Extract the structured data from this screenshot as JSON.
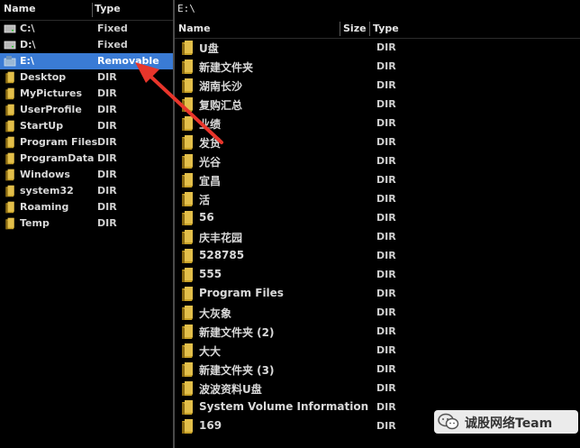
{
  "left": {
    "headers": {
      "name": "Name",
      "type": "Type"
    },
    "drives": [
      {
        "label": "C:\\",
        "type": "Fixed"
      },
      {
        "label": "D:\\",
        "type": "Fixed"
      },
      {
        "label": "E:\\",
        "type": "Removable"
      }
    ],
    "folders": [
      {
        "label": "Desktop",
        "type": "DIR"
      },
      {
        "label": "MyPictures",
        "type": "DIR"
      },
      {
        "label": "UserProfile",
        "type": "DIR"
      },
      {
        "label": "StartUp",
        "type": "DIR"
      },
      {
        "label": "Program Files",
        "type": "DIR"
      },
      {
        "label": "ProgramData",
        "type": "DIR"
      },
      {
        "label": "Windows",
        "type": "DIR"
      },
      {
        "label": "system32",
        "type": "DIR"
      },
      {
        "label": "Roaming",
        "type": "DIR"
      },
      {
        "label": "Temp",
        "type": "DIR"
      }
    ]
  },
  "right": {
    "path": "E:\\",
    "headers": {
      "name": "Name",
      "size": "Size",
      "type": "Type"
    },
    "items": [
      {
        "label": "U盘",
        "type": "DIR"
      },
      {
        "label": "新建文件夹",
        "type": "DIR"
      },
      {
        "label": "湖南长沙",
        "type": "DIR"
      },
      {
        "label": "复购汇总",
        "type": "DIR"
      },
      {
        "label": "业绩",
        "type": "DIR"
      },
      {
        "label": "发货",
        "type": "DIR"
      },
      {
        "label": "光谷",
        "type": "DIR"
      },
      {
        "label": "宜昌",
        "type": "DIR"
      },
      {
        "label": "活",
        "type": "DIR"
      },
      {
        "label": "56",
        "type": "DIR"
      },
      {
        "label": "庆丰花园",
        "type": "DIR"
      },
      {
        "label": "528785",
        "type": "DIR"
      },
      {
        "label": "555",
        "type": "DIR"
      },
      {
        "label": "Program Files",
        "type": "DIR"
      },
      {
        "label": "大灰象",
        "type": "DIR"
      },
      {
        "label": "新建文件夹 (2)",
        "type": "DIR"
      },
      {
        "label": "大大",
        "type": "DIR"
      },
      {
        "label": "新建文件夹 (3)",
        "type": "DIR"
      },
      {
        "label": "波波资料U盘",
        "type": "DIR"
      },
      {
        "label": "System Volume Information",
        "type": "DIR"
      },
      {
        "label": "169",
        "type": "DIR"
      }
    ]
  },
  "watermark": {
    "text": "诚股网络Team"
  },
  "colors": {
    "selection": "#3a7bd5",
    "folder": "#c9a227",
    "arrow": "#e8352b",
    "background": "#000000"
  },
  "icons": {
    "drive": "drive-icon",
    "folder": "folder-icon",
    "removable": "removable-drive-icon"
  }
}
